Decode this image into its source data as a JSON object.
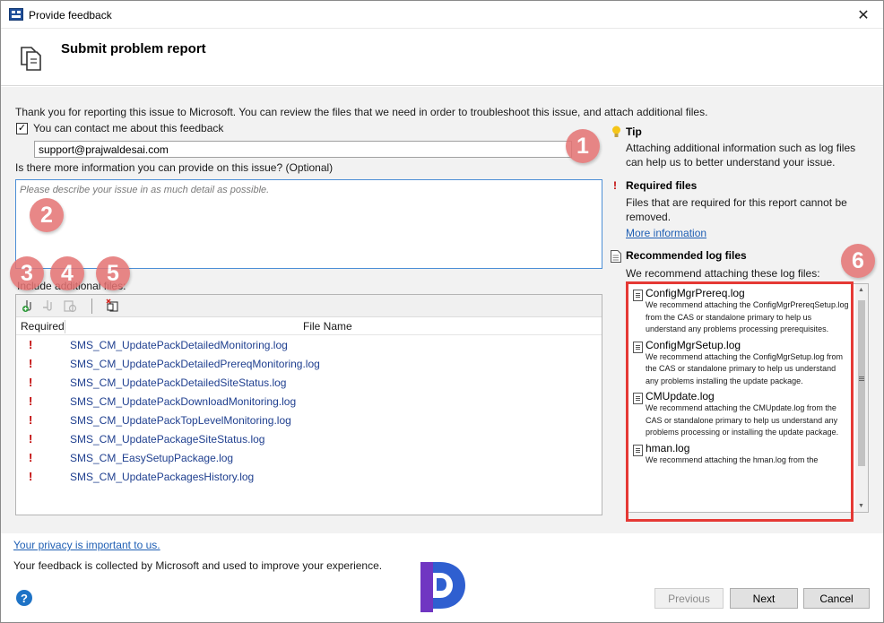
{
  "window": {
    "title": "Provide feedback",
    "close_glyph": "✕"
  },
  "header": {
    "title": "Submit problem report",
    "icon": "copy-documents-icon"
  },
  "intro": "Thank you for reporting this issue to Microsoft. You can review the files that we need in order to troubleshoot this issue, and attach additional files.",
  "contact": {
    "checked": true,
    "label": "You can contact me about this feedback",
    "email": "support@prajwaldesai.com"
  },
  "more_info": {
    "label": "Is there more information you can provide on this issue? (Optional)",
    "placeholder": "Please describe your issue in as much detail as possible."
  },
  "include_files": {
    "label": "Include additional files:",
    "toolbar": [
      "add-file-icon",
      "remove-file-icon",
      "open-file-icon",
      "delete-file-icon"
    ],
    "columns": {
      "required": "Required",
      "file_name": "File Name"
    },
    "files": [
      {
        "required": "!",
        "name": "SMS_CM_UpdatePackDetailedMonitoring.log"
      },
      {
        "required": "!",
        "name": "SMS_CM_UpdatePackDetailedPrereqMonitoring.log"
      },
      {
        "required": "!",
        "name": "SMS_CM_UpdatePackDetailedSiteStatus.log"
      },
      {
        "required": "!",
        "name": "SMS_CM_UpdatePackDownloadMonitoring.log"
      },
      {
        "required": "!",
        "name": "SMS_CM_UpdatePackTopLevelMonitoring.log"
      },
      {
        "required": "!",
        "name": "SMS_CM_UpdatePackageSiteStatus.log"
      },
      {
        "required": "!",
        "name": "SMS_CM_EasySetupPackage.log"
      },
      {
        "required": "!",
        "name": "SMS_CM_UpdatePackagesHistory.log"
      }
    ]
  },
  "tip": {
    "heading": "Tip",
    "text": "Attaching additional information such as log files can help us to better understand your issue."
  },
  "required_files": {
    "heading": "Required files",
    "text": "Files that are required for this report cannot be removed.",
    "link": "More information"
  },
  "recommended": {
    "heading": "Recommended log files",
    "intro": "We recommend attaching these log files:",
    "logs": [
      {
        "title": "ConfigMgrPrereq.log",
        "desc": "We recommend attaching the ConfigMgrPrereqSetup.log from the CAS or standalone primary to help us understand any problems processing prerequisites."
      },
      {
        "title": "ConfigMgrSetup.log",
        "desc": "We recommend attaching the ConfigMgrSetup.log from the CAS or standalone primary to help us understand any problems installing the update package."
      },
      {
        "title": "CMUpdate.log",
        "desc": "We recommend attaching the CMUpdate.log from the CAS or standalone primary to help us understand any problems processing or installing the update package."
      },
      {
        "title": "hman.log",
        "desc": "We recommend attaching the hman.log from the"
      }
    ]
  },
  "callouts": [
    "1",
    "2",
    "3",
    "4",
    "5",
    "6"
  ],
  "footer": {
    "privacy_link": "Your privacy is important to us.",
    "collected": "Your feedback is collected by Microsoft and used to improve your experience.",
    "help_glyph": "?",
    "logo": "prajwal-desai-logo",
    "buttons": {
      "previous": "Previous",
      "next": "Next",
      "cancel": "Cancel"
    }
  },
  "colors": {
    "required_mark": "#c00000",
    "file_link": "#1f3f8f",
    "link": "#1f5fb4",
    "callout": "#e57373",
    "highlight_frame": "#e53935",
    "logo_blue": "#2f5fd0",
    "logo_purple": "#7b2fbf"
  }
}
